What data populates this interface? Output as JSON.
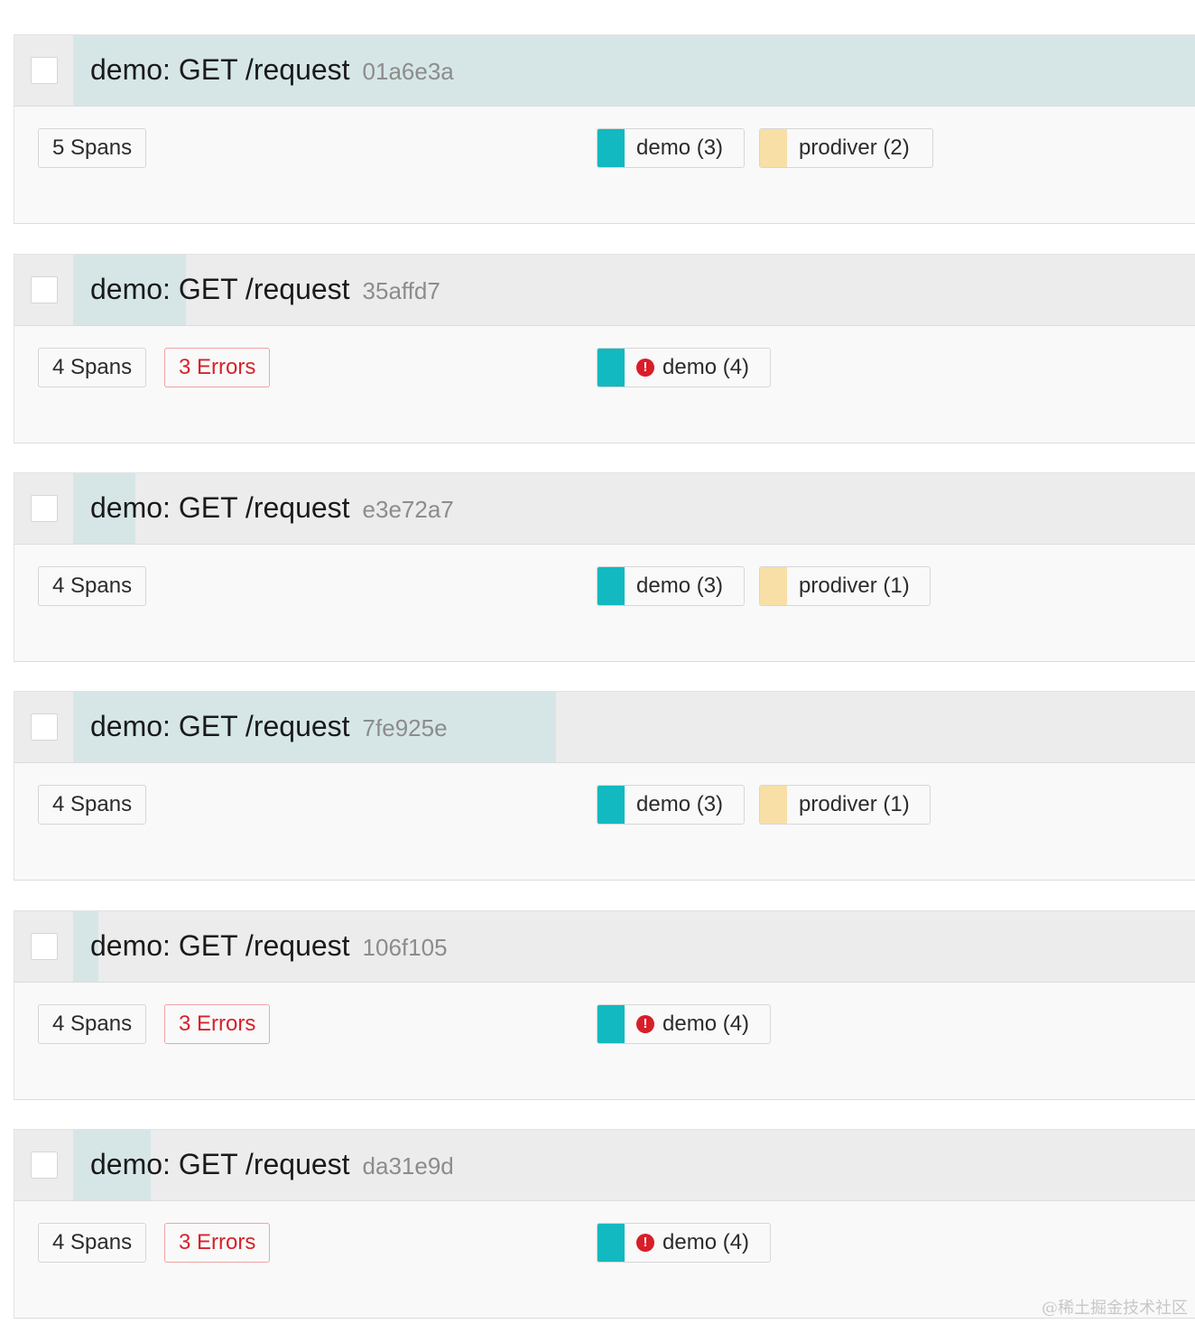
{
  "colors": {
    "demo": "#13b9c0",
    "prodiver": "#f7dfa6",
    "duration_bar": "#d6e6e7",
    "error": "#d6222b"
  },
  "traces": [
    {
      "name": "demo: GET /request",
      "id": "01a6e3a",
      "spans": "5 Spans",
      "errors": null,
      "duration_fraction": 1.0,
      "services": [
        {
          "label": "demo (3)",
          "color": "#13b9c0",
          "error": false
        },
        {
          "label": "prodiver (2)",
          "color": "#f7dfa6",
          "error": false
        }
      ]
    },
    {
      "name": "demo: GET /request",
      "id": "35affd7",
      "spans": "4 Spans",
      "errors": "3 Errors",
      "duration_fraction": 0.1,
      "services": [
        {
          "label": "demo (4)",
          "color": "#13b9c0",
          "error": true
        }
      ]
    },
    {
      "name": "demo: GET /request",
      "id": "e3e72a7",
      "spans": "4 Spans",
      "errors": null,
      "duration_fraction": 0.055,
      "services": [
        {
          "label": "demo (3)",
          "color": "#13b9c0",
          "error": false
        },
        {
          "label": "prodiver (1)",
          "color": "#f7dfa6",
          "error": false
        }
      ]
    },
    {
      "name": "demo: GET /request",
      "id": "7fe925e",
      "spans": "4 Spans",
      "errors": null,
      "duration_fraction": 0.43,
      "services": [
        {
          "label": "demo (3)",
          "color": "#13b9c0",
          "error": false
        },
        {
          "label": "prodiver (1)",
          "color": "#f7dfa6",
          "error": false
        }
      ]
    },
    {
      "name": "demo: GET /request",
      "id": "106f105",
      "spans": "4 Spans",
      "errors": "3 Errors",
      "duration_fraction": 0.022,
      "services": [
        {
          "label": "demo (4)",
          "color": "#13b9c0",
          "error": true
        }
      ]
    },
    {
      "name": "demo: GET /request",
      "id": "da31e9d",
      "spans": "4 Spans",
      "errors": "3 Errors",
      "duration_fraction": 0.068,
      "services": [
        {
          "label": "demo (4)",
          "color": "#13b9c0",
          "error": true
        }
      ]
    }
  ],
  "error_icon": {
    "name": "exclamation-circle-icon",
    "glyph": "!"
  },
  "watermark": "@稀土掘金技术社区"
}
